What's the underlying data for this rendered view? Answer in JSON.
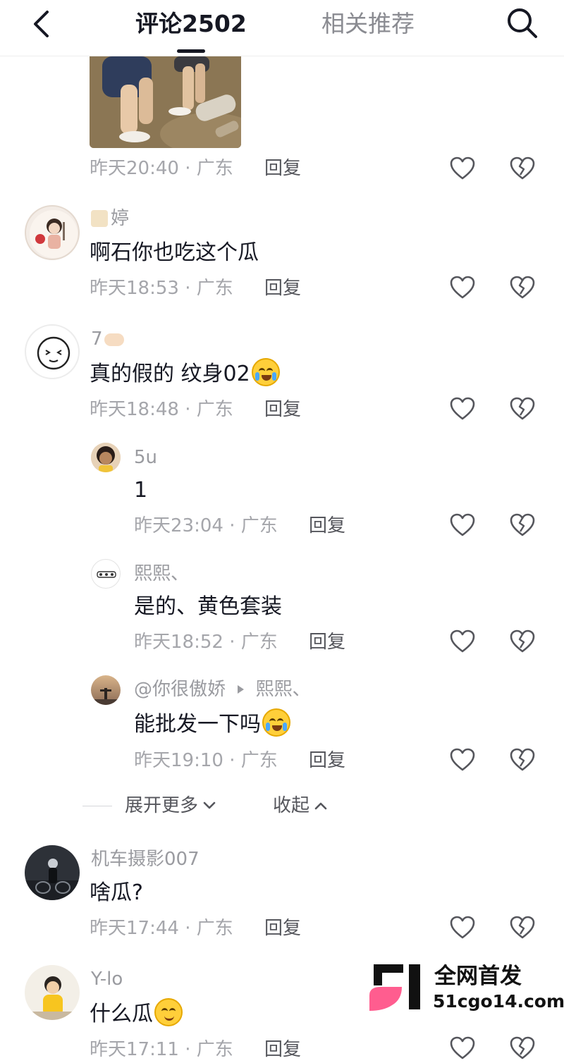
{
  "header": {
    "tab_comments": "评论2502",
    "tab_related": "相关推荐"
  },
  "colors": {
    "text_primary": "#161823",
    "text_secondary": "#9a9ba0",
    "watermark_pink": "#ff5d8f"
  },
  "icons": {
    "back": "chevron-left-icon",
    "search": "search-icon",
    "like": "heart-outline-icon",
    "dislike": "broken-heart-icon"
  },
  "comments": [
    {
      "meta_time": "昨天20:40",
      "meta_region": "广东",
      "reply_label": "回复"
    },
    {
      "username": "婷",
      "text": "啊石你也吃这个瓜",
      "meta_time": "昨天18:53",
      "meta_region": "广东",
      "reply_label": "回复"
    },
    {
      "username": "7",
      "text": "真的假的 纹身02",
      "meta_time": "昨天18:48",
      "meta_region": "广东",
      "reply_label": "回复"
    },
    {
      "username": "5u",
      "text": "1",
      "meta_time": "昨天23:04",
      "meta_region": "广东",
      "reply_label": "回复"
    },
    {
      "username": "熙熙、",
      "text": "是的、黄色套装",
      "meta_time": "昨天18:52",
      "meta_region": "广东",
      "reply_label": "回复"
    },
    {
      "username": "@你很傲娇",
      "reply_to": "熙熙、",
      "text": "能批发一下吗",
      "meta_time": "昨天19:10",
      "meta_region": "广东",
      "reply_label": "回复"
    },
    {
      "username": "机车摄影007",
      "text": "啥瓜?",
      "meta_time": "昨天17:44",
      "meta_region": "广东",
      "reply_label": "回复"
    },
    {
      "username": "Y-lo",
      "text": "什么瓜",
      "meta_time": "昨天17:11",
      "meta_region": "广东",
      "reply_label": "回复"
    }
  ],
  "thread_controls": {
    "expand_label": "展开更多",
    "collapse_label": "收起"
  },
  "watermark": {
    "title": "全网首发",
    "url": "51cgo14.com"
  }
}
